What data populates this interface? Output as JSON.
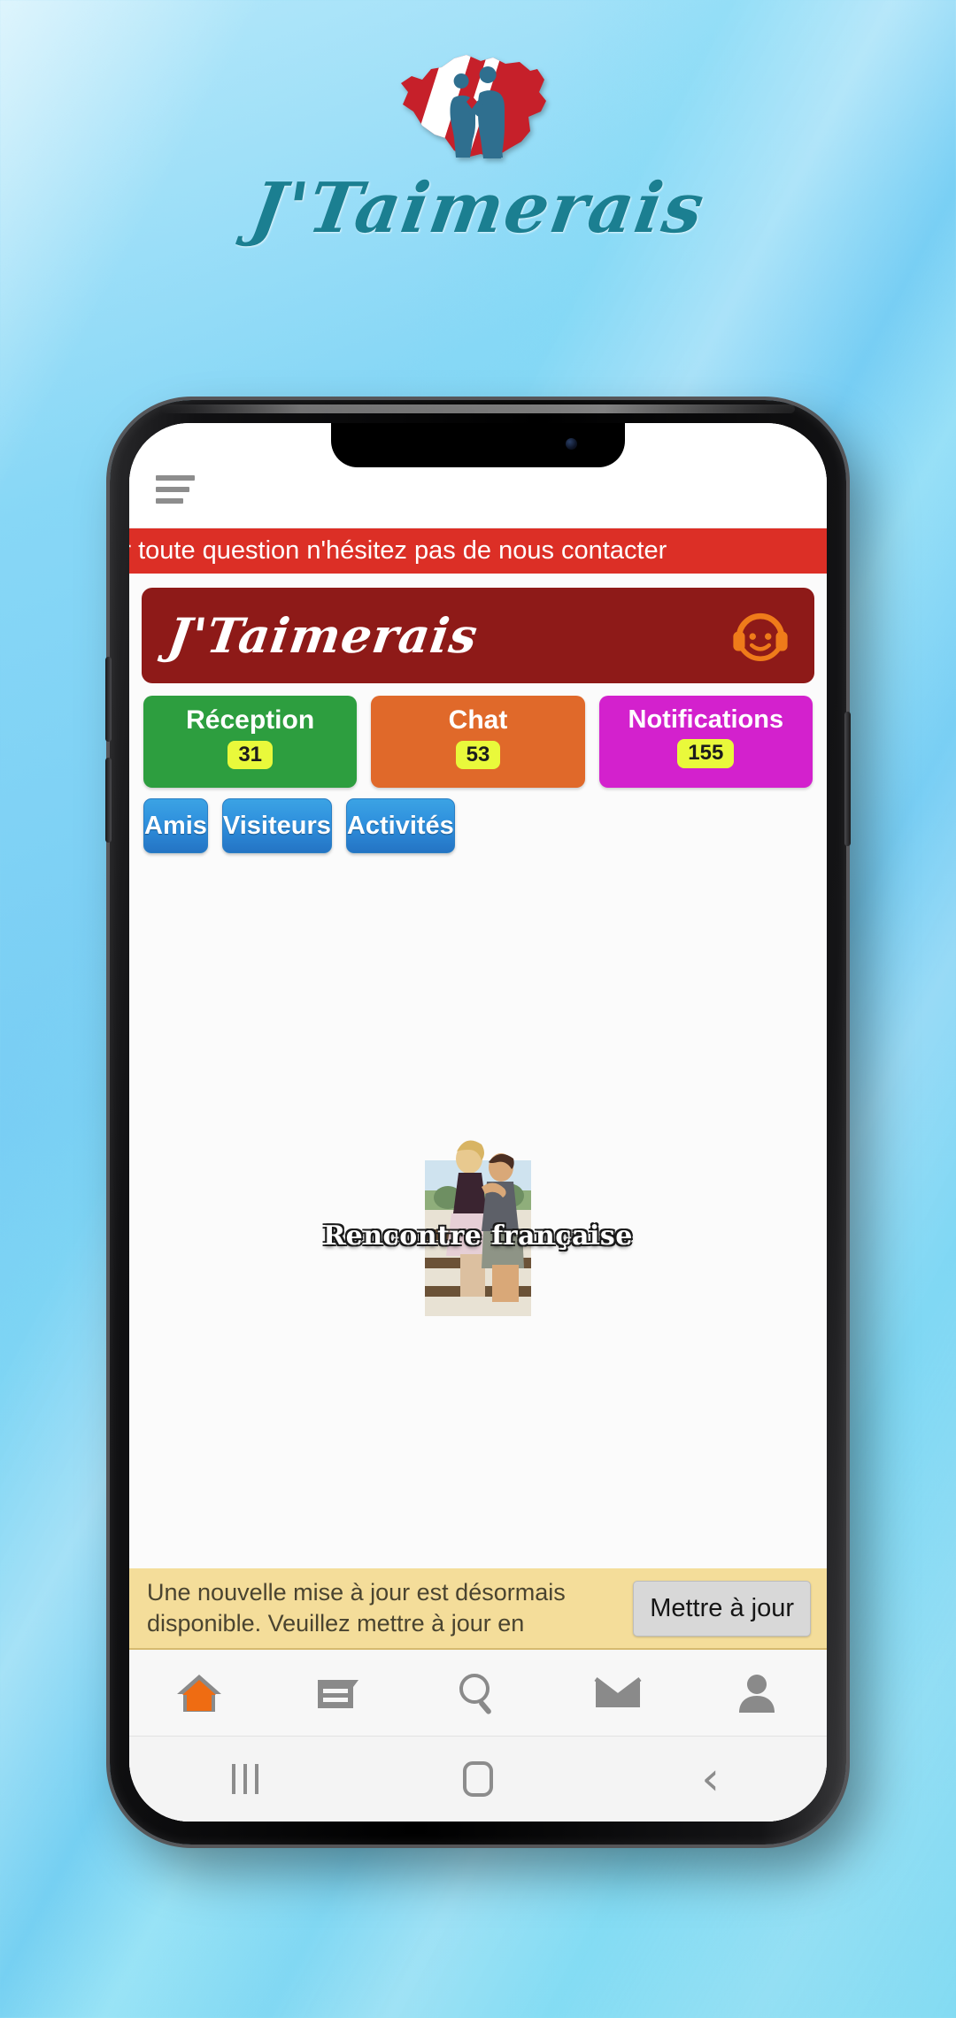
{
  "splash": {
    "logo_icon": "france-map-couple-logo",
    "title": "J'Taimerais"
  },
  "phone": {
    "status_icons": {
      "camera": "front-camera"
    }
  },
  "app": {
    "menu_icon": "hamburger-menu-icon",
    "marquee_text": "pour toute question n'hésitez pas de nous contacter",
    "brand": {
      "name": "J'Taimerais",
      "support_icon": "headset-support-icon"
    },
    "tiles_primary": [
      {
        "label": "Réception",
        "badge": "31",
        "color": "#2d9e3f",
        "name": "reception"
      },
      {
        "label": "Chat",
        "badge": "53",
        "color": "#e0692a",
        "name": "chat"
      },
      {
        "label": "Notifications",
        "badge": "155",
        "color": "#d321cd",
        "name": "notifications"
      }
    ],
    "tiles_secondary": [
      {
        "label": "Amis",
        "name": "amis"
      },
      {
        "label": "Visiteurs",
        "name": "visiteurs"
      },
      {
        "label": "Activités",
        "name": "activites"
      }
    ],
    "promo": {
      "caption": "Rencontre française",
      "image_icon": "couple-photo"
    },
    "update_banner": {
      "message": "Une nouvelle mise à jour est désormais disponible. Veuillez mettre à jour en",
      "button_label": "Mettre à jour",
      "background": "#f4dd9a"
    },
    "bottom_nav": [
      {
        "name": "home",
        "icon": "home-icon",
        "active": true
      },
      {
        "name": "feed",
        "icon": "feed-icon",
        "active": false
      },
      {
        "name": "search",
        "icon": "search-icon",
        "active": false
      },
      {
        "name": "messages",
        "icon": "envelope-icon",
        "active": false
      },
      {
        "name": "profile",
        "icon": "person-icon",
        "active": false
      }
    ]
  },
  "system_nav": {
    "recents_icon": "recents-icon",
    "home_icon": "home-square-icon",
    "back_icon": "back-chevron-icon"
  },
  "colors": {
    "marquee_red": "#dc2f26",
    "brand_dark_red": "#8e1a18",
    "badge_yellow": "#e9f93b",
    "accent_orange": "#ef6c12",
    "title_teal": "#1b7f91"
  }
}
